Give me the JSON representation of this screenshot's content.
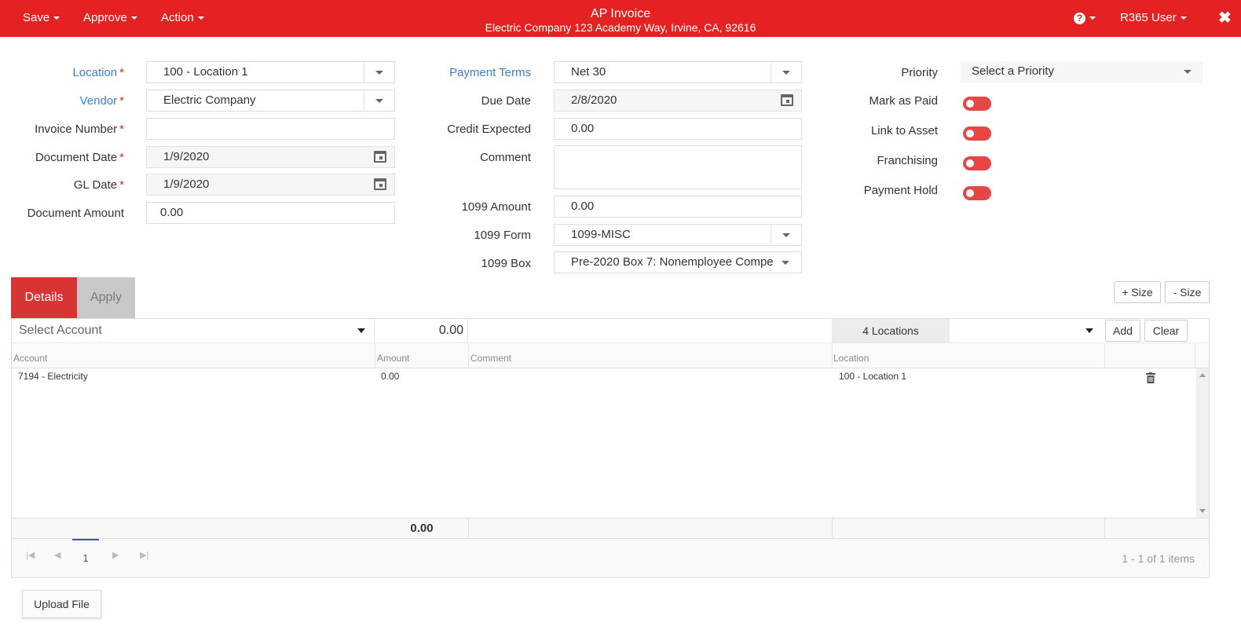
{
  "header": {
    "menus": [
      "Save",
      "Approve",
      "Action"
    ],
    "title": "AP Invoice",
    "subtitle": "Electric Company 123 Academy Way, Irvine, CA, 92616",
    "help_icon": "question-circle-icon",
    "user": "R365 User",
    "close_icon": "close-icon",
    "bar_color": "#e52222"
  },
  "form": {
    "location": {
      "label": "Location",
      "value": "100 - Location 1"
    },
    "vendor": {
      "label": "Vendor",
      "value": "Electric Company"
    },
    "invoice_number": {
      "label": "Invoice Number",
      "value": ""
    },
    "document_date": {
      "label": "Document Date",
      "value": "1/9/2020"
    },
    "gl_date": {
      "label": "GL Date",
      "value": "1/9/2020"
    },
    "document_amount": {
      "label": "Document Amount",
      "value": "0.00"
    },
    "payment_terms": {
      "label": "Payment Terms",
      "value": "Net 30"
    },
    "due_date": {
      "label": "Due Date",
      "value": "2/8/2020"
    },
    "credit_expected": {
      "label": "Credit Expected",
      "value": "0.00"
    },
    "comment": {
      "label": "Comment",
      "value": ""
    },
    "amount_1099": {
      "label": "1099 Amount",
      "value": "0.00"
    },
    "form_1099": {
      "label": "1099 Form",
      "value": "1099-MISC"
    },
    "box_1099": {
      "label": "1099 Box",
      "value": "Pre-2020 Box 7: Nonemployee Compe"
    },
    "priority": {
      "label": "Priority",
      "placeholder": "Select a Priority"
    },
    "mark_as_paid": {
      "label": "Mark as Paid"
    },
    "link_to_asset": {
      "label": "Link to Asset"
    },
    "franchising": {
      "label": "Franchising"
    },
    "payment_hold": {
      "label": "Payment Hold"
    },
    "required_mark": "*"
  },
  "tabs": {
    "details": "Details",
    "apply": "Apply"
  },
  "size_buttons": {
    "plus": "+ Size",
    "minus": "- Size"
  },
  "entry": {
    "account_placeholder": "Select Account",
    "amount": "0.00",
    "locations": "4 Locations",
    "add": "Add",
    "clear": "Clear"
  },
  "grid": {
    "columns": [
      "Account",
      "Amount",
      "Comment",
      "Location"
    ],
    "rows": [
      {
        "account": "7194 - Electricity",
        "amount": "0.00",
        "comment": "",
        "location": "100 - Location 1"
      }
    ],
    "total": "0.00",
    "delete_icon": "trash-icon"
  },
  "pager": {
    "current_page": "1",
    "summary": "1 - 1 of 1 items"
  },
  "upload": "Upload File"
}
